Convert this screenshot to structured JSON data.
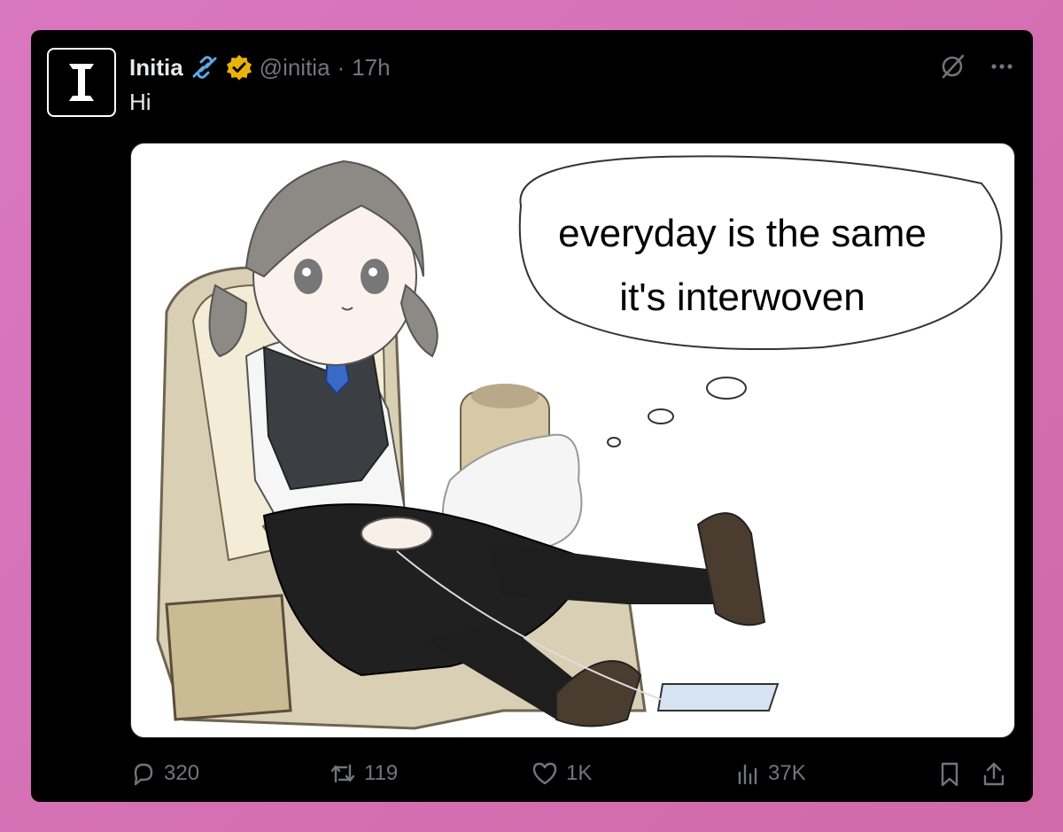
{
  "post": {
    "author_name": "Initia",
    "handle": "@initia",
    "separator": "·",
    "time": "17h",
    "text": "Hi",
    "avatar_letter": "I",
    "verified": true
  },
  "media": {
    "bubble_line1": "everyday is the same",
    "bubble_line2": "it's interwoven"
  },
  "actions": {
    "replies": "320",
    "reposts": "119",
    "likes": "1K",
    "views": "37K"
  },
  "icons": {
    "reply": "reply-icon",
    "repost": "repost-icon",
    "like": "heart-icon",
    "views": "views-chart-icon",
    "bookmark": "bookmark-icon",
    "share": "share-icon",
    "grok": "grok-icon",
    "more": "more-icon",
    "link_emoji": "chain-link-icon",
    "verified": "verified-badge-icon"
  },
  "colors": {
    "background": "#000000",
    "text_primary": "#e7e9ea",
    "text_secondary": "#71767b",
    "verified_gold": "#e8b30a",
    "page_bg": "#d977c0"
  }
}
